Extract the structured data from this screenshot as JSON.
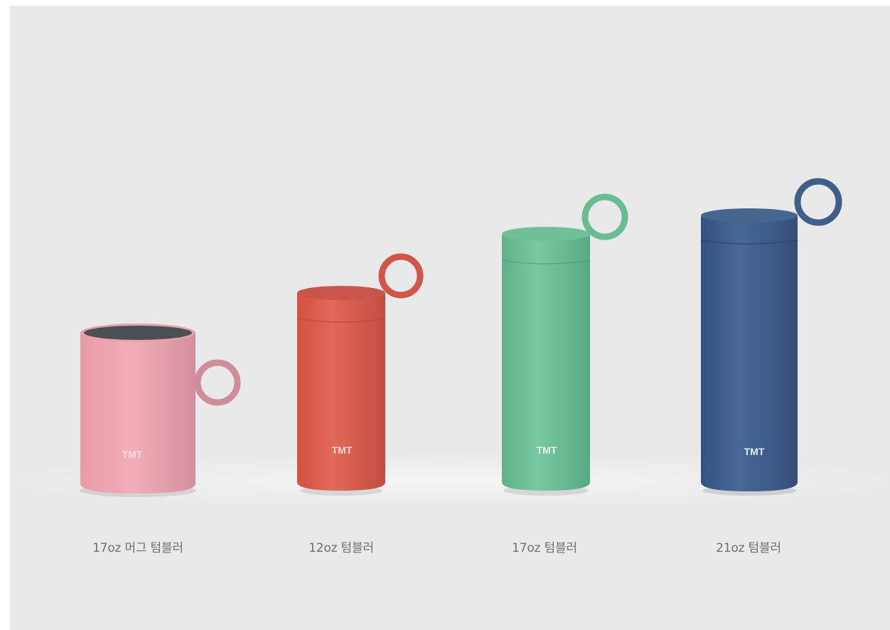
{
  "products": [
    {
      "caption": "17oz 머그 텀블러",
      "brand": "TMT",
      "color": "#e8a3ad"
    },
    {
      "caption": "12oz 텀블러",
      "brand": "TMT",
      "color": "#d9584b"
    },
    {
      "caption": "17oz 텀블러",
      "brand": "TMT",
      "color": "#6cc097"
    },
    {
      "caption": "21oz 텀블러",
      "brand": "TMT",
      "color": "#3e5f8c"
    }
  ]
}
